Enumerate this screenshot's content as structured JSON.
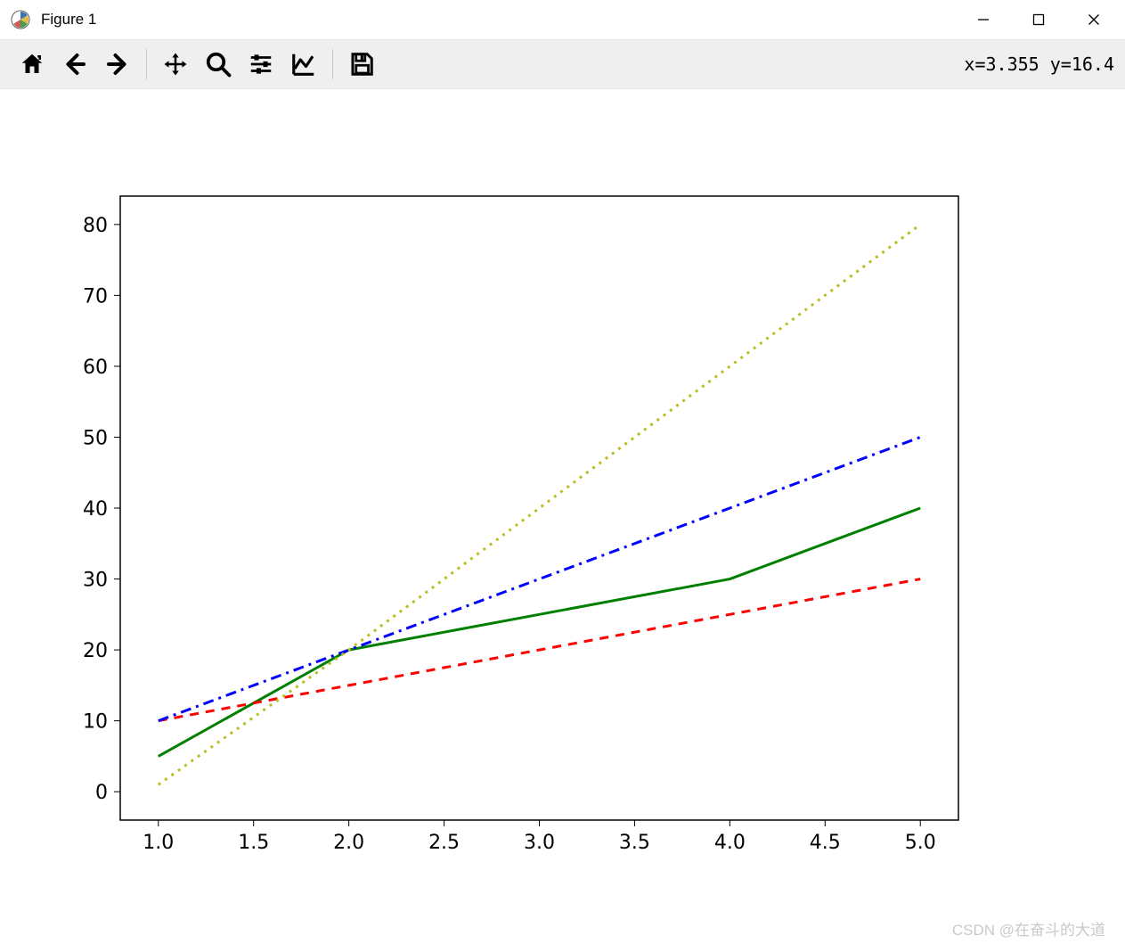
{
  "window": {
    "title": "Figure 1"
  },
  "toolbar": {
    "coord_text": "x=3.355 y=16.4"
  },
  "watermark": "CSDN @在奋斗的大道",
  "chart_data": {
    "type": "line",
    "xlabel": "",
    "ylabel": "",
    "title": "",
    "xlim": [
      1.0,
      5.0
    ],
    "ylim": [
      0,
      80
    ],
    "x_ticks": [
      "1.0",
      "1.5",
      "2.0",
      "2.5",
      "3.0",
      "3.5",
      "4.0",
      "4.5",
      "5.0"
    ],
    "y_ticks": [
      "0",
      "10",
      "20",
      "30",
      "40",
      "50",
      "60",
      "70",
      "80"
    ],
    "x": [
      1,
      2,
      3,
      4,
      5
    ],
    "series": [
      {
        "name": "green-solid",
        "color": "#008000",
        "style": "solid",
        "values": [
          5,
          20,
          25,
          30,
          40
        ]
      },
      {
        "name": "red-dashed",
        "color": "#ff0000",
        "style": "dashed",
        "values": [
          10,
          15,
          20,
          25,
          30
        ]
      },
      {
        "name": "blue-dashdot",
        "color": "#0000ff",
        "style": "dashdot",
        "values": [
          10,
          20,
          30,
          40,
          50
        ]
      },
      {
        "name": "olive-dotted",
        "color": "#bcbd22",
        "style": "dotted",
        "values": [
          1,
          20,
          40,
          60,
          80
        ]
      }
    ]
  }
}
